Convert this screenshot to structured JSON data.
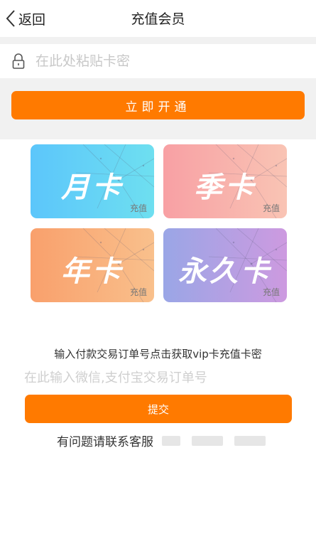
{
  "header": {
    "back_label": "返回",
    "title": "充值会员"
  },
  "card_key": {
    "placeholder": "在此处粘贴卡密",
    "submit_label": "立即开通"
  },
  "cards": [
    {
      "name": "月卡",
      "sub": "充值"
    },
    {
      "name": "季卡",
      "sub": "充值"
    },
    {
      "name": "年卡",
      "sub": "充值"
    },
    {
      "name": "永久卡",
      "sub": "充值"
    }
  ],
  "order": {
    "instruction": "输入付款交易订单号点击获取vip卡充值卡密",
    "placeholder": "在此输入微信,支付宝交易订单号",
    "submit_label": "提交"
  },
  "contact": {
    "text": "有问题请联系客服"
  },
  "colors": {
    "accent": "#ff7a00",
    "band": "#f1f1f1"
  }
}
